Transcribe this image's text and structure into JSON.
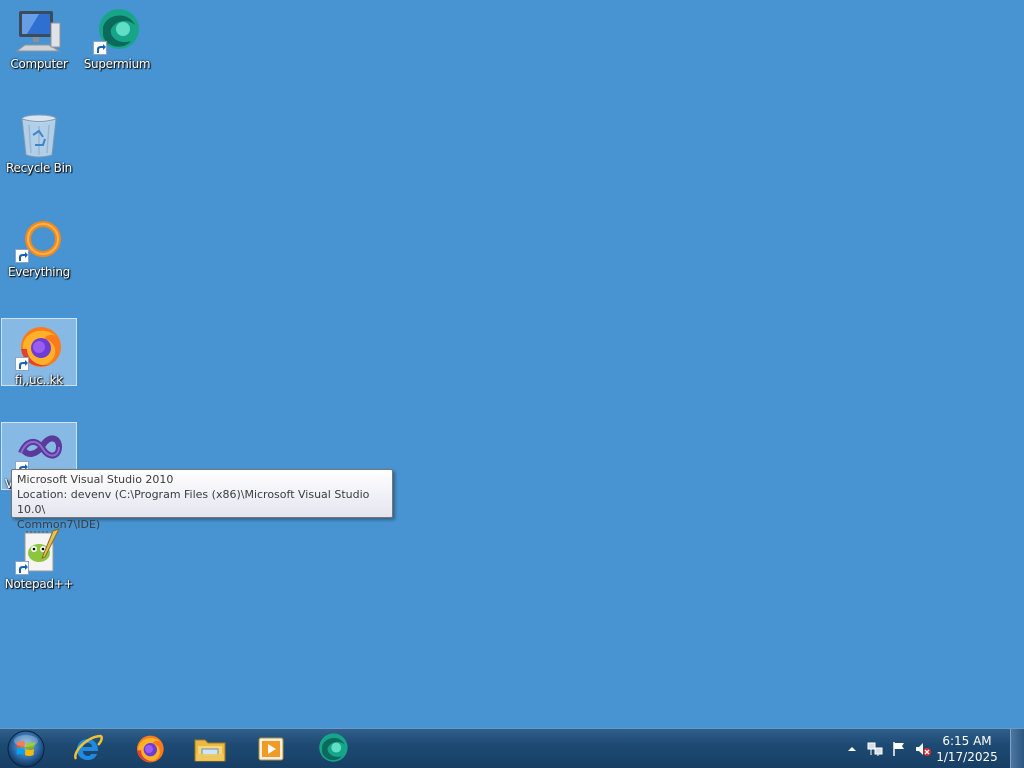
{
  "desktop": {
    "icons": [
      {
        "label": "Computer",
        "icon": "computer-icon"
      },
      {
        "label": "Supermium",
        "icon": "supermium-icon"
      },
      {
        "label": "Recycle Bin",
        "icon": "recycle-bin-icon"
      },
      {
        "label": "Everything",
        "icon": "everything-icon"
      },
      {
        "label": "fi,,uc..kk",
        "icon": "firefox-icon"
      },
      {
        "label": "V",
        "icon": "visual-studio-icon"
      },
      {
        "label": "Notepad++",
        "icon": "notepadpp-icon"
      }
    ],
    "background_color": "#4894d2"
  },
  "tooltip": {
    "line1": "Microsoft Visual Studio 2010",
    "line2": "Location: devenv (C:\\Program Files (x86)\\Microsoft Visual Studio 10.0\\",
    "line3": "Common7\\IDE)"
  },
  "taskbar": {
    "pinned": [
      {
        "icon": "internet-explorer-icon"
      },
      {
        "icon": "firefox-icon"
      },
      {
        "icon": "file-explorer-icon"
      },
      {
        "icon": "media-player-icon"
      },
      {
        "icon": "supermium-icon"
      }
    ],
    "tray": {
      "icons": [
        "show-hidden-icons-arrow",
        "network-icon",
        "action-center-flag-icon",
        "volume-muted-icon"
      ]
    },
    "clock": {
      "time": "6:15 AM",
      "date": "1/17/2025"
    }
  }
}
